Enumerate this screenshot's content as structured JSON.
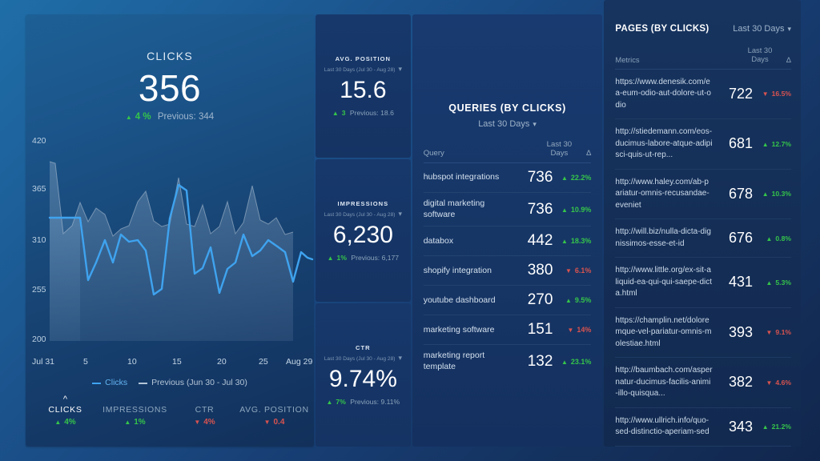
{
  "clicks_panel": {
    "title": "CLICKS",
    "value": "356",
    "delta": "4 %",
    "delta_dir": "up",
    "previous": "Previous: 344",
    "y_ticks": [
      "420",
      "365",
      "310",
      "255",
      "200"
    ],
    "x_ticks": [
      "Jul 31",
      "5",
      "10",
      "15",
      "20",
      "25",
      "Aug 29"
    ],
    "legend": [
      {
        "label": "Clicks",
        "color": "#3fa3ef"
      },
      {
        "label": "Previous (Jun 30 - Jul 30)",
        "color": "#b4c5d6"
      }
    ],
    "tabs": [
      {
        "name": "CLICKS",
        "delta": "4%",
        "dir": "up",
        "active": true
      },
      {
        "name": "IMPRESSIONS",
        "delta": "1%",
        "dir": "up",
        "active": false
      },
      {
        "name": "CTR",
        "delta": "4%",
        "dir": "down",
        "active": false
      },
      {
        "name": "AVG. POSITION",
        "delta": "0.4",
        "dir": "down",
        "active": false
      }
    ]
  },
  "mini_cards": [
    {
      "title": "AVG. POSITION",
      "range": "Last 30 Days (Jul 30 - Aug 28)",
      "value": "15.6",
      "delta": "3",
      "delta_dir": "up",
      "previous": "Previous: 18.6"
    },
    {
      "title": "IMPRESSIONS",
      "range": "Last 30 Days (Jul 30 - Aug 28)",
      "value": "6,230",
      "delta": "1%",
      "delta_dir": "up",
      "previous": "Previous: 6,177"
    },
    {
      "title": "CTR",
      "range": "Last 30 Days (Jul 30 - Aug 28)",
      "value": "9.74%",
      "delta": "7%",
      "delta_dir": "up",
      "previous": "Previous: 9.11%"
    }
  ],
  "queries_panel": {
    "title": "QUERIES (BY CLICKS)",
    "range": "Last 30 Days",
    "col_query": "Query",
    "col_value": "Last 30 Days",
    "col_delta": "Δ",
    "rows": [
      {
        "query": "hubspot integrations",
        "value": "736",
        "change": "22.2%",
        "dir": "up"
      },
      {
        "query": "digital marketing software",
        "value": "736",
        "change": "10.9%",
        "dir": "up"
      },
      {
        "query": "databox",
        "value": "442",
        "change": "18.3%",
        "dir": "up"
      },
      {
        "query": "shopify integration",
        "value": "380",
        "change": "6.1%",
        "dir": "down"
      },
      {
        "query": "youtube dashboard",
        "value": "270",
        "change": "9.5%",
        "dir": "up"
      },
      {
        "query": "marketing software",
        "value": "151",
        "change": "14%",
        "dir": "down"
      },
      {
        "query": "marketing report template",
        "value": "132",
        "change": "23.1%",
        "dir": "up"
      }
    ]
  },
  "pages_panel": {
    "title": "PAGES (BY CLICKS)",
    "range": "Last 30 Days",
    "col_metrics": "Metrics",
    "col_value": "Last 30 Days",
    "col_delta": "Δ",
    "rows": [
      {
        "url": "https://www.denesik.com/ea-eum-odio-aut-dolore-ut-odio",
        "value": "722",
        "change": "16.5%",
        "dir": "down"
      },
      {
        "url": "http://stiedemann.com/eos-ducimus-labore-atque-adipisci-quis-ut-rep...",
        "value": "681",
        "change": "12.7%",
        "dir": "up"
      },
      {
        "url": "http://www.haley.com/ab-pariatur-omnis-recusandae-eveniet",
        "value": "678",
        "change": "10.3%",
        "dir": "up"
      },
      {
        "url": "http://will.biz/nulla-dicta-dignissimos-esse-et-id",
        "value": "676",
        "change": "0.8%",
        "dir": "up"
      },
      {
        "url": "http://www.little.org/ex-sit-aliquid-ea-qui-qui-saepe-dicta.html",
        "value": "431",
        "change": "5.3%",
        "dir": "up"
      },
      {
        "url": "https://champlin.net/doloremque-vel-pariatur-omnis-molestiae.html",
        "value": "393",
        "change": "9.1%",
        "dir": "down"
      },
      {
        "url": "http://baumbach.com/aspernatur-ducimus-facilis-animi-illo-quisqua...",
        "value": "382",
        "change": "4.6%",
        "dir": "down"
      },
      {
        "url": "http://www.ullrich.info/quo-sed-distinctio-aperiam-sed",
        "value": "343",
        "change": "21.2%",
        "dir": "up"
      }
    ]
  },
  "chart_data": {
    "type": "line",
    "title": "CLICKS",
    "xlabel": "",
    "ylabel": "",
    "ylim": [
      200,
      420
    ],
    "grid": false,
    "legend_position": "bottom",
    "x_tick_labels": [
      "Jul 31",
      "5",
      "10",
      "15",
      "20",
      "25",
      "Aug 29"
    ],
    "y_tick_labels": [
      "420",
      "365",
      "310",
      "255",
      "200"
    ],
    "series": [
      {
        "name": "Clicks",
        "color": "#3fa3ef",
        "values": [
          311,
          311,
          232,
          255,
          283,
          255,
          290,
          281,
          283,
          270,
          214,
          221,
          310,
          352,
          345,
          240,
          247,
          272,
          218,
          248,
          256,
          290,
          262,
          270,
          283,
          276,
          268,
          231,
          268,
          260,
          258
        ]
      },
      {
        "name": "Previous (Jun 30 - Jul 30)",
        "color": "#b4c5d6",
        "values": [
          365,
          362,
          250,
          262,
          302,
          268,
          292,
          280,
          240,
          252,
          258,
          300,
          318,
          268,
          258,
          262,
          340,
          262,
          258,
          295,
          250,
          258,
          300,
          246,
          265,
          328,
          270,
          262,
          272,
          244,
          248
        ]
      }
    ]
  }
}
